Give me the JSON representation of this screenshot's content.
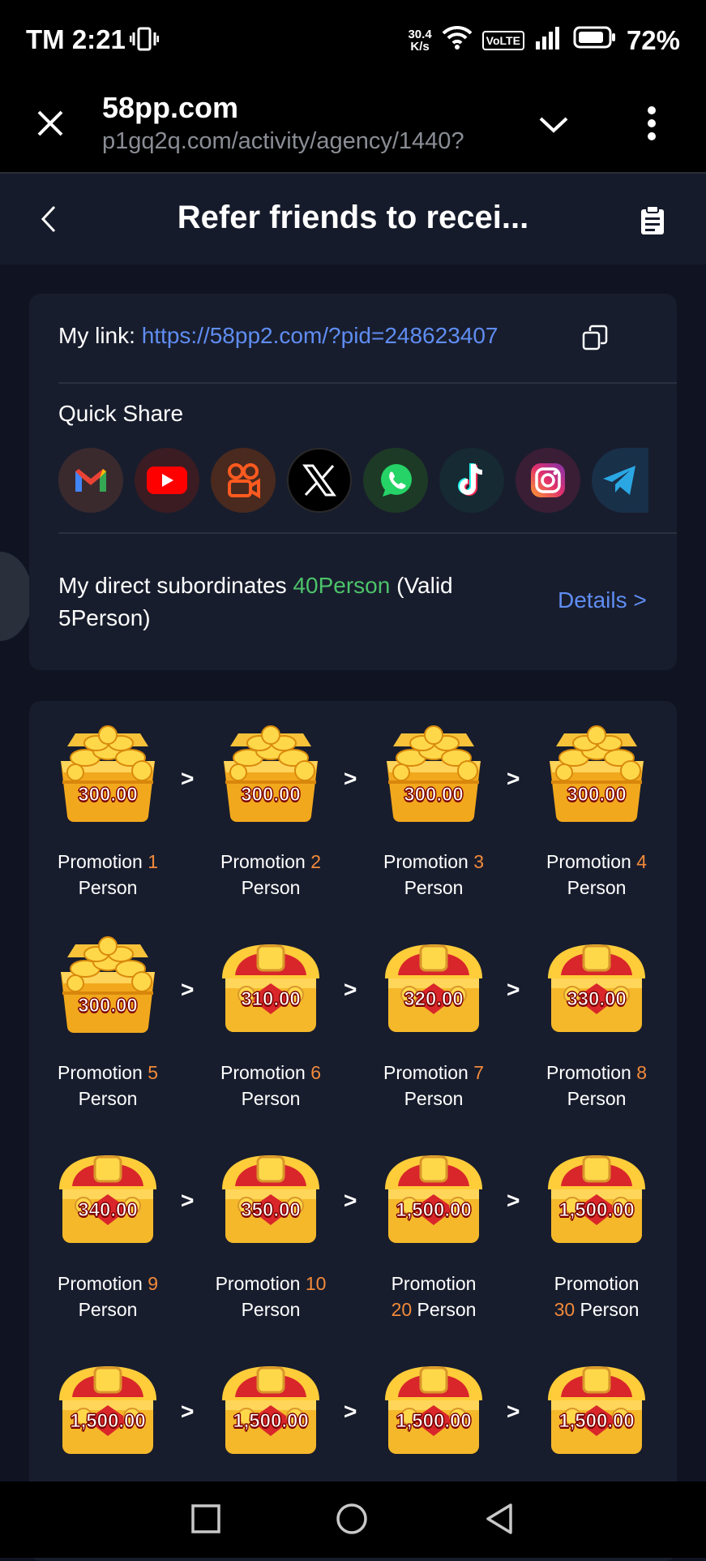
{
  "status": {
    "carrier_time": "TM 2:21",
    "net_speed_top": "30.4",
    "net_speed_bottom": "K/s",
    "volte": "VoLTE",
    "battery": "72%"
  },
  "browser": {
    "site": "58pp.com",
    "url": "p1gq2q.com/activity/agency/1440?"
  },
  "header": {
    "title": "Refer friends to recei..."
  },
  "link_card": {
    "my_link_label": "My link:",
    "my_link_url": "https://58pp2.com/?pid=248623407",
    "quick_share_label": "Quick Share",
    "share_icons": [
      "gmail-icon",
      "youtube-icon",
      "kuaishou-icon",
      "x-icon",
      "whatsapp-icon",
      "tiktok-icon",
      "instagram-icon",
      "telegram-icon"
    ],
    "subordinates_prefix": "My direct subordinates",
    "subordinates_count": "40Person",
    "subordinates_valid": "(Valid",
    "subordinates_valid_count": "5Person)",
    "details_label": "Details >"
  },
  "rewards": [
    {
      "amount": "300.00",
      "prefix": "Promotion",
      "num": "1",
      "suffix": "Person",
      "type": "coins"
    },
    {
      "amount": "300.00",
      "prefix": "Promotion",
      "num": "2",
      "suffix": "Person",
      "type": "coins"
    },
    {
      "amount": "300.00",
      "prefix": "Promotion",
      "num": "3",
      "suffix": "Person",
      "type": "coins"
    },
    {
      "amount": "300.00",
      "prefix": "Promotion",
      "num": "4",
      "suffix": "Person",
      "type": "coins"
    },
    {
      "amount": "300.00",
      "prefix": "Promotion",
      "num": "5",
      "suffix": "Person",
      "type": "coins"
    },
    {
      "amount": "310.00",
      "prefix": "Promotion",
      "num": "6",
      "suffix": "Person",
      "type": "chest"
    },
    {
      "amount": "320.00",
      "prefix": "Promotion",
      "num": "7",
      "suffix": "Person",
      "type": "chest"
    },
    {
      "amount": "330.00",
      "prefix": "Promotion",
      "num": "8",
      "suffix": "Person",
      "type": "chest"
    },
    {
      "amount": "340.00",
      "prefix": "Promotion",
      "num": "9",
      "suffix": "Person",
      "type": "chest"
    },
    {
      "amount": "350.00",
      "prefix": "Promotion",
      "num": "10",
      "suffix": "Person",
      "type": "chest"
    },
    {
      "amount": "1,500.00",
      "prefix": "Promotion",
      "num": "20",
      "suffix": "Person",
      "type": "chest"
    },
    {
      "amount": "1,500.00",
      "prefix": "Promotion",
      "num": "30",
      "suffix": "Person",
      "type": "chest"
    },
    {
      "amount": "1,500.00",
      "type": "chest"
    },
    {
      "amount": "1,500.00",
      "type": "chest"
    },
    {
      "amount": "1,500.00",
      "type": "chest"
    },
    {
      "amount": "1,500.00",
      "type": "chest"
    }
  ],
  "arrow_symbol": ">",
  "colors": {
    "accent_link": "#5f8df2",
    "green": "#4cc36a",
    "orange": "#f28a3a",
    "bg": "#0f1322",
    "card": "#181d2d"
  }
}
